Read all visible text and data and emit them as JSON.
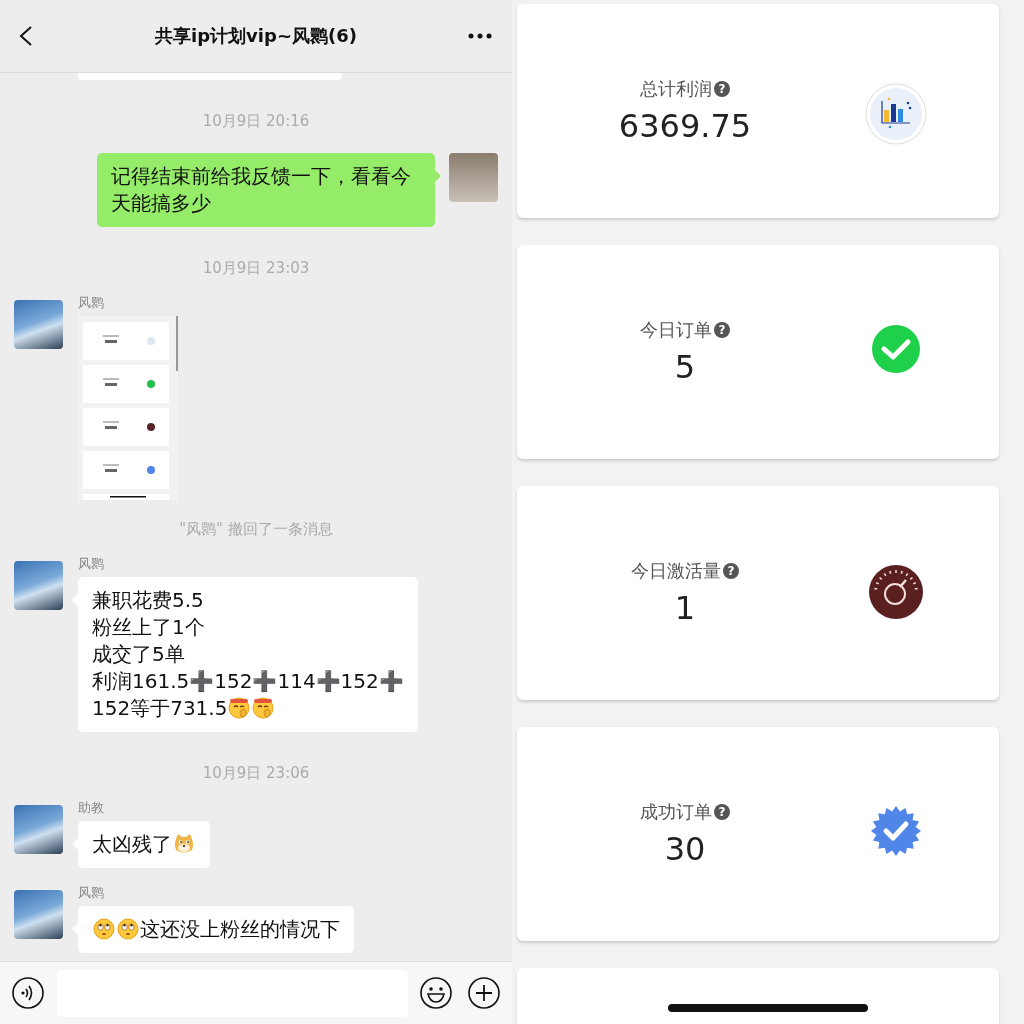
{
  "chat": {
    "title": "共享ip计划vip~风鹮(6)",
    "messages": [
      {
        "kind": "cut_bubble"
      },
      {
        "kind": "time",
        "text": "10月9日 20:16"
      },
      {
        "kind": "outgoing",
        "parts": [
          {
            "kind": "text",
            "text": "记得结束前给我反馈一下，看看今天能搞多少"
          }
        ]
      },
      {
        "kind": "time",
        "text": "10月9日 23:03"
      },
      {
        "kind": "incoming_image",
        "sender": "风鹮"
      },
      {
        "kind": "system",
        "text": "\"风鹮\" 撤回了一条消息"
      },
      {
        "kind": "incoming",
        "sender": "风鹮",
        "lines": [
          [
            {
              "kind": "text",
              "text": "兼职花费5.5"
            }
          ],
          [
            {
              "kind": "text",
              "text": "粉丝上了1个"
            }
          ],
          [
            {
              "kind": "text",
              "text": "成交了5单"
            }
          ],
          [
            {
              "kind": "text",
              "text": "利润161.5➕152➕114➕152➕"
            }
          ],
          [
            {
              "kind": "text",
              "text": "152等于731.5"
            },
            {
              "kind": "emoji_shush"
            },
            {
              "kind": "emoji_shush"
            }
          ]
        ]
      },
      {
        "kind": "time",
        "text": "10月9日 23:06"
      },
      {
        "kind": "incoming",
        "sender": "助教",
        "parts": [
          {
            "kind": "text",
            "text": "太凶残了"
          },
          {
            "kind": "emoji_doge"
          }
        ]
      },
      {
        "kind": "incoming",
        "sender": "风鹮",
        "parts": [
          {
            "kind": "emoji_eyeroll"
          },
          {
            "kind": "emoji_eyeroll"
          },
          {
            "kind": "text",
            "text": "这还没上粉丝的情况下"
          }
        ]
      }
    ]
  },
  "stats": [
    {
      "kind": "chart",
      "label": "总计利润",
      "hint": "?",
      "value": "6369.75"
    },
    {
      "kind": "check",
      "label": "今日订单",
      "hint": "?",
      "value": "5"
    },
    {
      "kind": "gauge",
      "label": "今日激活量",
      "hint": "?",
      "value": "1"
    },
    {
      "kind": "badge",
      "label": "成功订单",
      "hint": "?",
      "value": "30"
    },
    {
      "kind": "blank"
    }
  ]
}
